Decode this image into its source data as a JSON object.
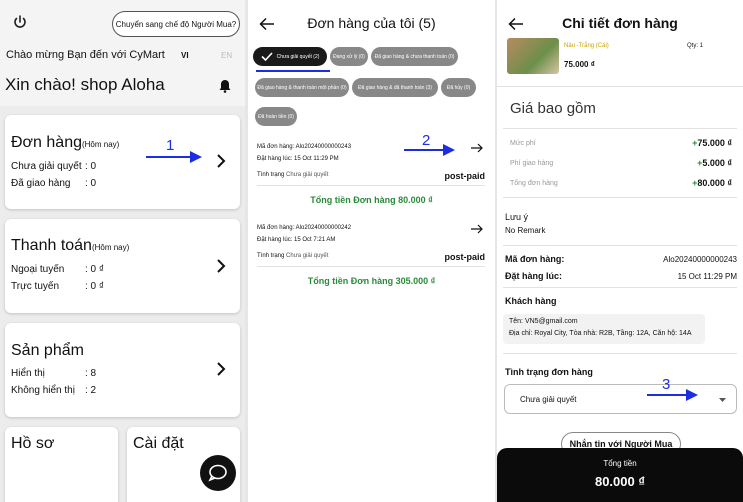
{
  "home": {
    "switch_button": "Chuyển sang chế độ Người Mua?",
    "welcome": "Chào mừng Bạn đến với CyMart",
    "lang_vi": "VI",
    "lang_en": "EN",
    "greeting": "Xin chào!  shop Aloha",
    "orders": {
      "title": "Đơn hàng",
      "sub": "(Hôm nay)",
      "rows": [
        {
          "label": "Chưa giải quyết",
          "value": ": 0"
        },
        {
          "label": "Đã giao hàng",
          "value": ": 0"
        }
      ]
    },
    "payment": {
      "title": "Thanh toán",
      "sub": "(Hôm nay)",
      "rows": [
        {
          "label": "Ngoại tuyến",
          "value": ": 0 ₫"
        },
        {
          "label": "Trực tuyến",
          "value": ": 0 ₫"
        }
      ]
    },
    "products": {
      "title": "Sản phẩm",
      "rows": [
        {
          "label": "Hiển thị",
          "value": ": 8"
        },
        {
          "label": "Không hiển thị",
          "value": ": 2"
        }
      ]
    },
    "profile": "Hồ sơ",
    "settings": "Cài đặt",
    "annotation": "1"
  },
  "orders_page": {
    "title": "Đơn hàng của tôi (5)",
    "chips": [
      "Chưa giải quyết (2)",
      "Đang xử lý (0)",
      "Đã giao hàng & chưa thanh toán (0)",
      "Đã giao hàng & thanh toán một phần (0)",
      "Đã giao hàng & đã thanh toán (3)",
      "Đã hủy (0)",
      "Đã hoàn tiền (0)"
    ],
    "orders": [
      {
        "code_label": "Mã đơn hàng:",
        "code": "Alo20240000000243",
        "date_label": "Đặt hàng lúc:",
        "date": "15 Oct 11:29 PM",
        "status_label": "Tình trạng",
        "status": "Chưa giải quyết",
        "payment": "post-paid",
        "total": "Tổng tiền Đơn hàng  80.000 ₫"
      },
      {
        "code_label": "Mã đơn hàng:",
        "code": "Alo20240000000242",
        "date_label": "Đặt hàng lúc:",
        "date": "15 Oct 7:21 AM",
        "status_label": "Tình trạng",
        "status": "Chưa giải quyết",
        "payment": "post-paid",
        "total": "Tổng tiền Đơn hàng  305.000 ₫"
      }
    ],
    "annotation": "2"
  },
  "detail_page": {
    "title": "Chi tiết đơn hàng",
    "item_variant": "Nâu -Trắng (Cái)",
    "item_price": "75.000 ₫",
    "item_qty": "Qty: 1",
    "price_section": "Giá bao gồm",
    "fees": [
      {
        "label": "Mức phí",
        "sign": "+",
        "value": "75.000 ₫"
      },
      {
        "label": "Phí giao hàng",
        "sign": "+",
        "value": "5.000 ₫"
      },
      {
        "label": "Tổng đơn hàng",
        "sign": "+",
        "value": "80.000 ₫"
      }
    ],
    "note_label": "Lưu ý",
    "note_value": "No Remark",
    "order_code_label": "Mã đơn hàng:",
    "order_code": "Alo20240000000243",
    "order_time_label": "Đặt hàng lúc:",
    "order_time": "15 Oct 11:29 PM",
    "customer_label": "Khách hàng",
    "customer_name": "Tên: VN5@gmail.com",
    "customer_address": "Địa chỉ: Royal City, Tòa nhà: R2B, Tầng: 12A, Căn hộ: 14A",
    "status_label": "Tình trạng đơn hàng",
    "status_value": "Chưa giải quyết",
    "message_button": "Nhắn tin với Người Mua",
    "total_label": "Tổng tiền",
    "total_value": "80.000 ₫",
    "annotation": "3"
  },
  "colors": {
    "annotation": "#1d2ee0",
    "green": "#2a8a3a",
    "dark": "#0b0b0b"
  }
}
